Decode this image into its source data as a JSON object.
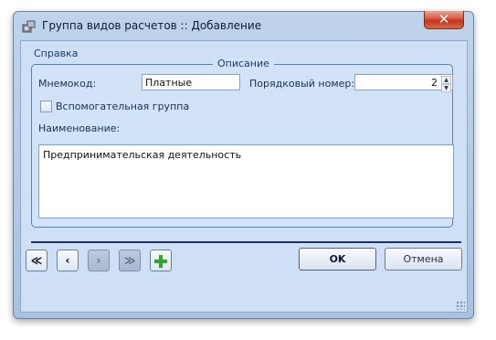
{
  "window": {
    "title": "Группа видов расчетов :: Добавление",
    "close_label": "✕"
  },
  "menu": {
    "help": "Справка"
  },
  "description_group": {
    "legend": "Описание",
    "mnemocode_label": "Мнемокод:",
    "mnemocode_value": "Платные",
    "order_label": "Порядковый номер:",
    "order_value": "2",
    "auxiliary_label": "Вспомогательная группа",
    "auxiliary_checked": false,
    "name_label": "Наименование:",
    "name_value": "Предпринимательская деятельность"
  },
  "nav": {
    "first": "≪",
    "prev": "‹",
    "next": "›",
    "last": "≫",
    "add": "+"
  },
  "buttons": {
    "ok": "OK",
    "cancel": "Отмена"
  },
  "colors": {
    "accent": "#1a2f6e",
    "close_red": "#c5321a",
    "add_green": "#2fa52f"
  }
}
